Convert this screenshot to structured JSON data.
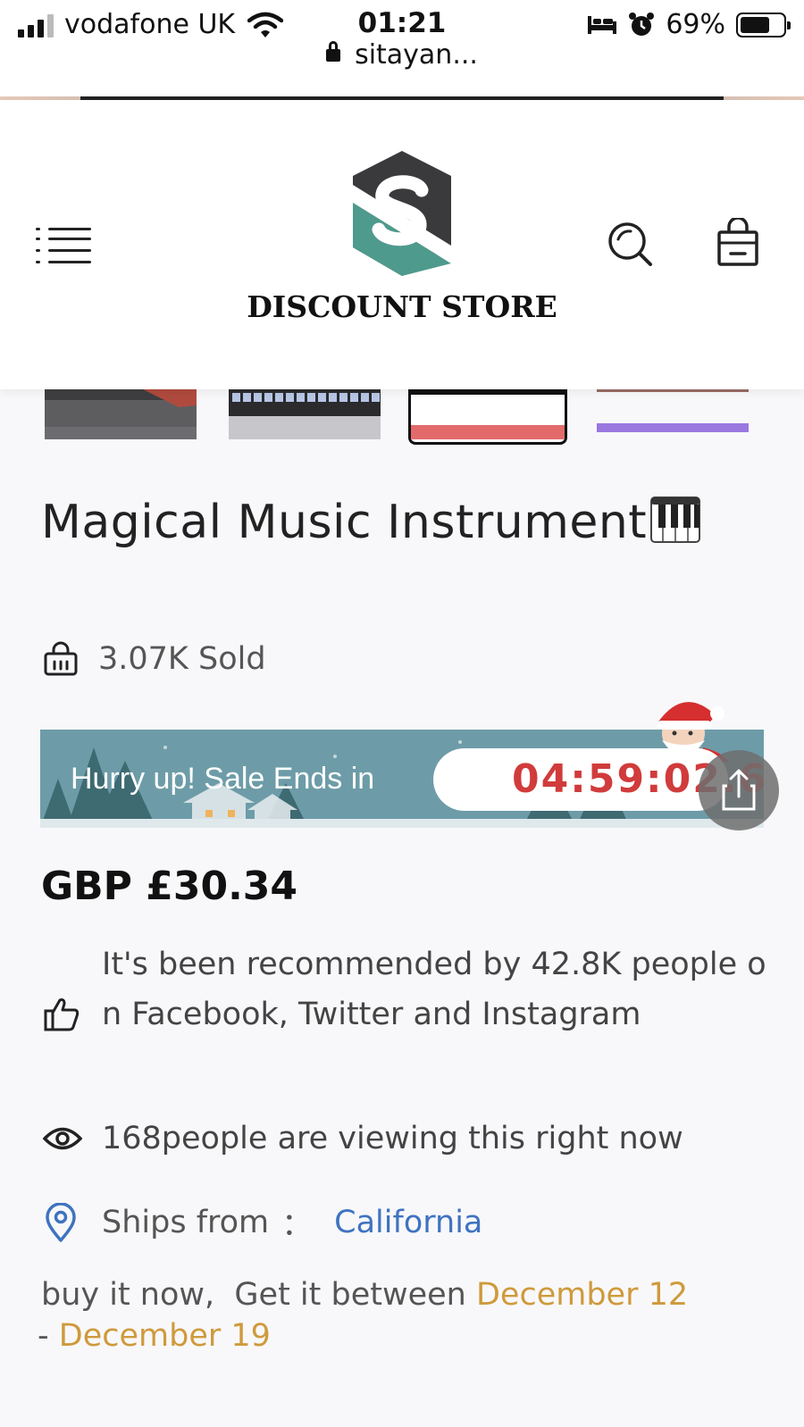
{
  "status_bar": {
    "carrier": "vodafone UK",
    "time": "01:21",
    "url": "sitayan...",
    "battery": "69%",
    "battery_level": 0.69
  },
  "header": {
    "brand": "DISCOUNT STORE",
    "logo_colors": {
      "dark": "#3a3a3d",
      "teal": "#4e9a8d"
    }
  },
  "thumbnails": [
    {
      "name": "thumb-1",
      "selected": false
    },
    {
      "name": "thumb-2",
      "selected": false
    },
    {
      "name": "thumb-3",
      "selected": true
    },
    {
      "name": "thumb-4",
      "selected": false
    }
  ],
  "product": {
    "title": "Magical Music Instrument",
    "title_emoji": "piano-emoji",
    "sold": "3.07K Sold",
    "sale_banner": {
      "text": "Hurry up! Sale Ends in",
      "countdown": "04:59:02.6"
    },
    "price": "GBP £30.34",
    "recommended": "It's been recommended by 42.8K people on Facebook, Twitter and Instagram",
    "viewing": "168people are viewing this right now",
    "ships_from_label": "Ships from",
    "ships_from_sep": "：",
    "ships_from_place": "California",
    "delivery_prefix": "buy it now,  Get it between ",
    "delivery_start": "December 12",
    "delivery_dash": " - ",
    "delivery_end": "December 19"
  },
  "colors": {
    "accent_link": "#3f73c0",
    "date_highlight": "#cf9a3c",
    "countdown": "#d13b3b",
    "banner": "#6f9fab"
  }
}
